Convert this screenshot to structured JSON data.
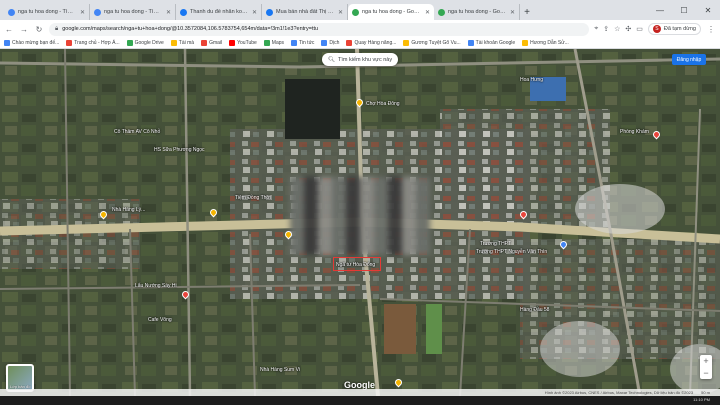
{
  "tabs": [
    {
      "title": "nga tu hoa dong - Tìm trên Go",
      "favicon_color": "#4285f4",
      "active": false
    },
    {
      "title": "nga tu hoa dong - Tìm trên Go",
      "favicon_color": "#4285f4",
      "active": false
    },
    {
      "title": "Thanh du đề nhân ko không c",
      "favicon_color": "#1877f2",
      "active": false
    },
    {
      "title": "Mua bán nhà đất Thị xã Gò Cô",
      "favicon_color": "#1877f2",
      "active": false
    },
    {
      "title": "nga tu hoa dong - Google Maps",
      "favicon_color": "#34a853",
      "active": true
    },
    {
      "title": "nga tu hoa dong - Google Maps",
      "favicon_color": "#34a853",
      "active": false
    }
  ],
  "toolbar": {
    "url": "google.com/maps/search/nga+tu+hoa+dong/@10.3572084,106.5783754,654m/data=!3m1!1e3?entry=ttu",
    "profile_label": "Đã tạm dừng",
    "avatar_letter": "S"
  },
  "bookmarks": [
    {
      "label": "Chào mừng bạn đế...",
      "color": "#4285f4"
    },
    {
      "label": "Trang chủ - Hợp Á...",
      "color": "#ea4335"
    },
    {
      "label": "Google Drive",
      "color": "#34a853"
    },
    {
      "label": "Tài mà",
      "color": "#fbbc05"
    },
    {
      "label": "Gmail",
      "color": "#ea4335"
    },
    {
      "label": "YouTube",
      "color": "#ff0000"
    },
    {
      "label": "Maps",
      "color": "#34a853"
    },
    {
      "label": "Tin tức",
      "color": "#4285f4"
    },
    {
      "label": "Dịch",
      "color": "#4285f4"
    },
    {
      "label": "Quay Hàng năng...",
      "color": "#ea4335"
    },
    {
      "label": "Gương Tuyệt Gõ Vu...",
      "color": "#fbbc05"
    },
    {
      "label": "Tài khoản Google",
      "color": "#4285f4"
    },
    {
      "label": "Hương Dẫn Sử...",
      "color": "#fbbc05"
    }
  ],
  "map": {
    "search_this_area": "Tìm kiếm khu vực này",
    "save_button": "Đăng nhập",
    "layers_label": "Lớp bản đồ",
    "brand": "Google",
    "labels": [
      {
        "text": "Trường THPT"
      },
      {
        "text": "Cô Thảm AV Cô Nhỏ"
      },
      {
        "text": "HS Sữa Phương Ngọc"
      },
      {
        "text": "Chợ Hòa Đông"
      },
      {
        "text": "Tiệm Đồng Thời"
      },
      {
        "text": "Nhà Hàng Lý..."
      },
      {
        "text": "Lẩu Nướng Sáy Hi"
      },
      {
        "text": "Cafe Võng"
      },
      {
        "text": "Trường THPT Nguyễn Văn Thìn"
      },
      {
        "text": "Nhà Hàng Sum Vi"
      },
      {
        "text": "Hàng Đầu 58"
      },
      {
        "text": "Phòng Khám"
      },
      {
        "text": "Ngã tư Hòa Đông"
      },
      {
        "text": "Hoa Hưng"
      }
    ],
    "footer_text": "Hình ảnh ©2023 Airbus, CNES / Airbus, Maxar Technologies, Dữ liệu bản đồ ©2023",
    "footer_scale": "50 m"
  },
  "taskbar": {
    "clock": "11:10 PM"
  }
}
